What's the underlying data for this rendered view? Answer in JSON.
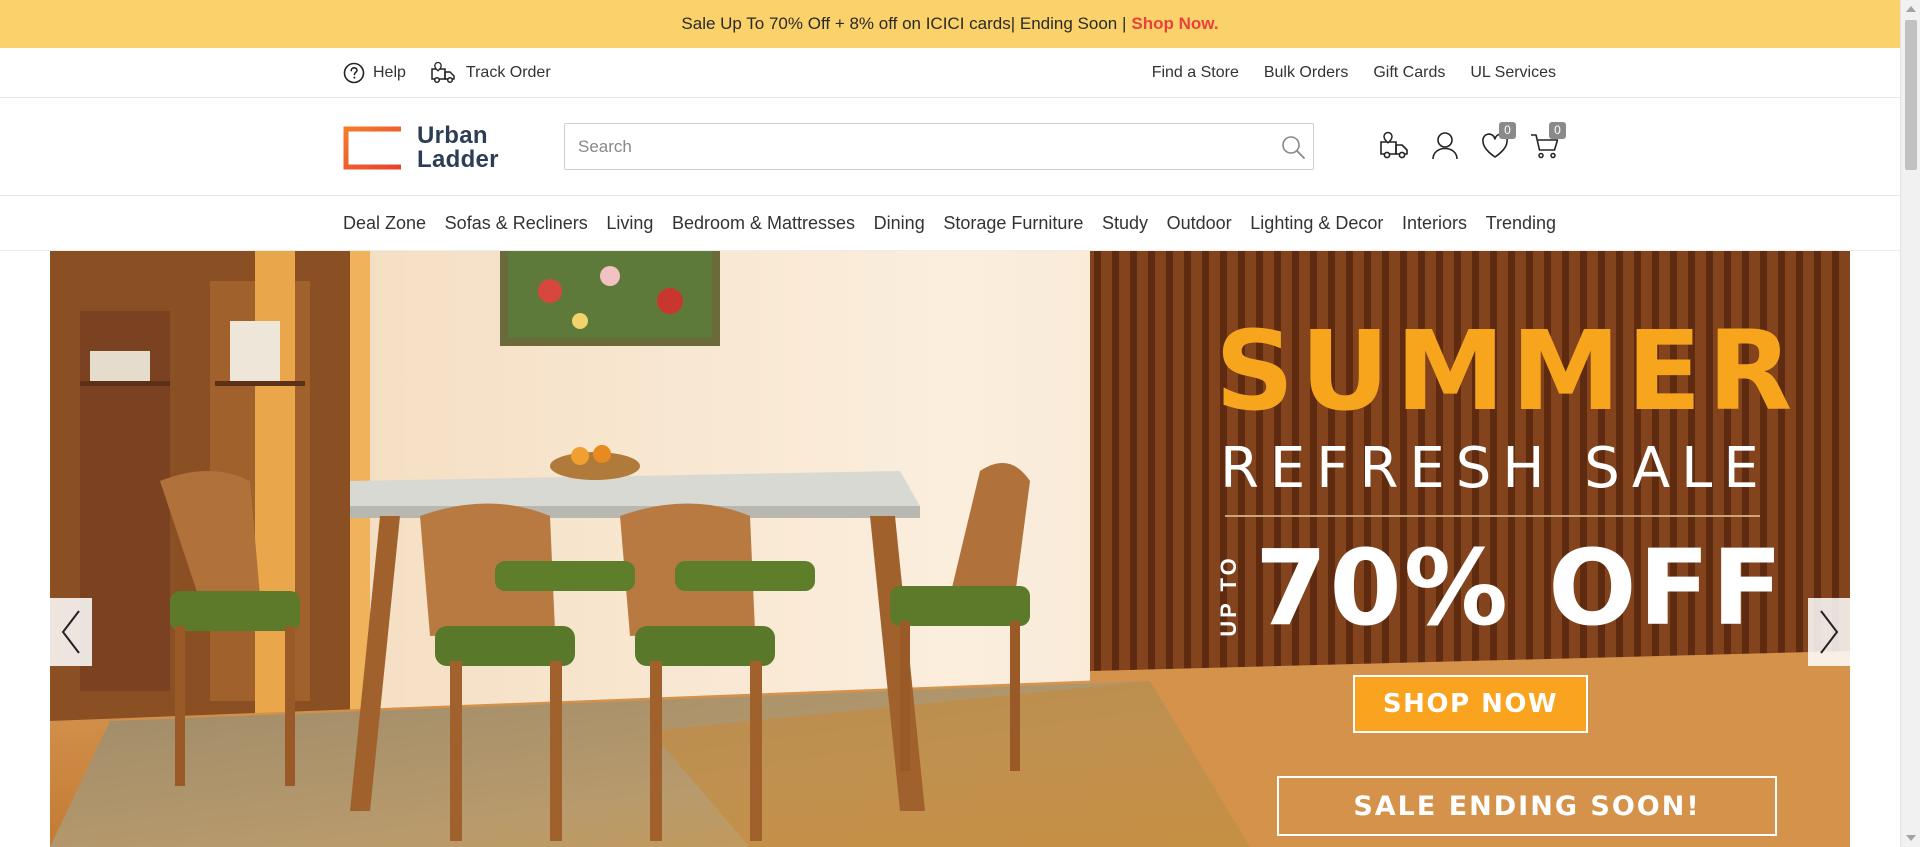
{
  "promo": {
    "text": "Sale Up To 70% Off + 8% off on ICICI cards| Ending Soon |",
    "link": "Shop Now."
  },
  "utility": {
    "left": [
      {
        "label": "Help",
        "icon": "help-circle-icon"
      },
      {
        "label": "Track Order",
        "icon": "truck-location-icon"
      }
    ],
    "right": [
      "Find a Store",
      "Bulk Orders",
      "Gift Cards",
      "UL Services"
    ]
  },
  "header": {
    "logo_line1": "Urban",
    "logo_line2": "Ladder",
    "search_placeholder": "Search",
    "wishlist_count": "0",
    "cart_count": "0"
  },
  "nav": [
    "Deal Zone",
    "Sofas & Recliners",
    "Living",
    "Bedroom & Mattresses",
    "Dining",
    "Storage Furniture",
    "Study",
    "Outdoor",
    "Lighting & Decor",
    "Interiors",
    "Trending"
  ],
  "hero": {
    "line1": "SUMMER",
    "line2": "REFRESH SALE",
    "upto": "UP TO",
    "discount": "70% OFF",
    "cta": "SHOP NOW",
    "ending": "SALE ENDING SOON!"
  },
  "colors": {
    "promo_bg": "#fbd26a",
    "promo_link": "#e8423f",
    "logo_orange": "#f05a28",
    "logo_text": "#2c3e56",
    "hero_accent": "#f7a51c"
  }
}
